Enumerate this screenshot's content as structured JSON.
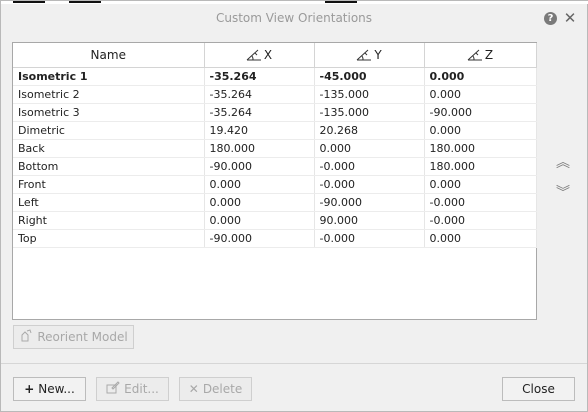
{
  "window": {
    "title": "Custom View Orientations"
  },
  "header_icons": {
    "help": "help-icon",
    "close": "close-icon"
  },
  "table": {
    "columns": [
      "Name",
      "X",
      "Y",
      "Z"
    ],
    "rows": [
      {
        "name": "Isometric 1",
        "x": "-35.264",
        "y": "-45.000",
        "z": "0.000",
        "selected": true
      },
      {
        "name": "Isometric 2",
        "x": "-35.264",
        "y": "-135.000",
        "z": "0.000"
      },
      {
        "name": "Isometric 3",
        "x": "-35.264",
        "y": "-135.000",
        "z": "-90.000"
      },
      {
        "name": "Dimetric",
        "x": "19.420",
        "y": "20.268",
        "z": "0.000"
      },
      {
        "name": "Back",
        "x": "180.000",
        "y": "0.000",
        "z": "180.000"
      },
      {
        "name": "Bottom",
        "x": "-90.000",
        "y": "-0.000",
        "z": "180.000"
      },
      {
        "name": "Front",
        "x": "0.000",
        "y": "-0.000",
        "z": "0.000"
      },
      {
        "name": "Left",
        "x": "0.000",
        "y": "-90.000",
        "z": "-0.000"
      },
      {
        "name": "Right",
        "x": "0.000",
        "y": "90.000",
        "z": "-0.000"
      },
      {
        "name": "Top",
        "x": "-90.000",
        "y": "-0.000",
        "z": "0.000"
      }
    ]
  },
  "buttons": {
    "reorient": "Reorient Model",
    "new": "New...",
    "edit": "Edit...",
    "delete": "Delete",
    "close": "Close"
  },
  "icons": {
    "move_up": "move-up-icon",
    "move_down": "move-down-icon",
    "reorient": "reorient-icon",
    "new": "plus-icon",
    "edit": "edit-icon",
    "delete": "delete-icon",
    "angle": "angle-icon"
  }
}
